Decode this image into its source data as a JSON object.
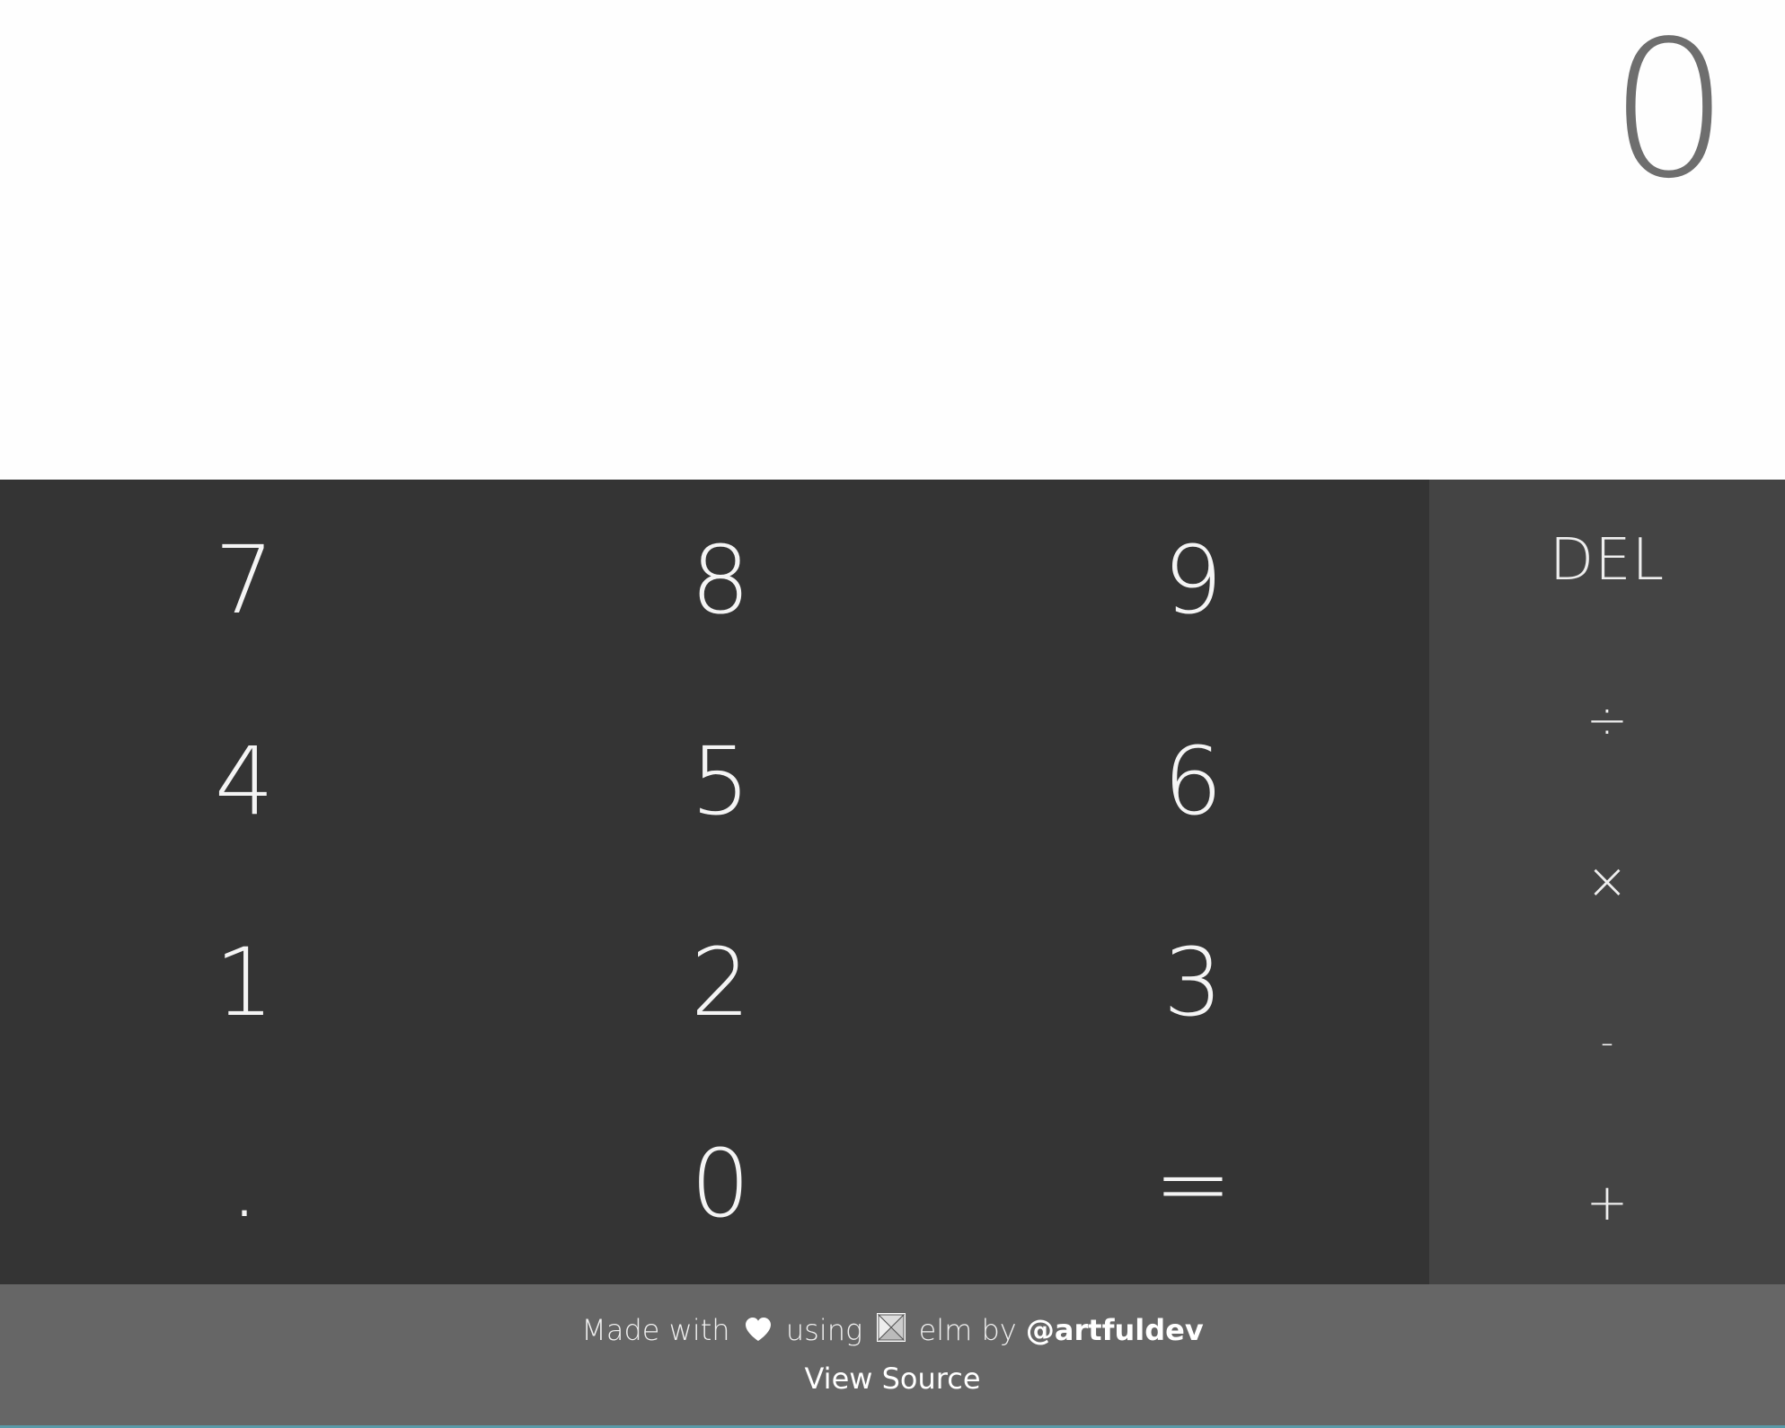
{
  "display": {
    "value": "0"
  },
  "keypad": {
    "rows": [
      [
        "7",
        "8",
        "9"
      ],
      [
        "4",
        "5",
        "6"
      ],
      [
        "1",
        "2",
        "3"
      ],
      [
        ".",
        "0",
        "="
      ]
    ]
  },
  "operators": {
    "del": "DEL",
    "divide": "÷",
    "multiply": "×",
    "subtract": "-",
    "add": "+"
  },
  "footer": {
    "made_with": "Made with",
    "using": "using",
    "elm": "elm by",
    "author": "@artfuldev",
    "view_source": "View Source"
  },
  "icons": {
    "heart": "heart-icon",
    "elm_logo": "elm-logo-icon"
  },
  "colors": {
    "display_bg": "#fefefe",
    "display_text": "#6e6e6e",
    "keypad_bg": "#343434",
    "operators_bg": "#444444",
    "footer_bg": "#666666",
    "key_text": "#f4f4f4"
  }
}
